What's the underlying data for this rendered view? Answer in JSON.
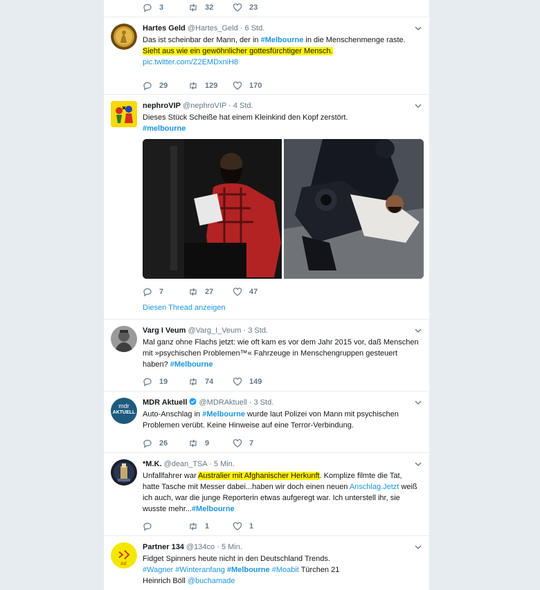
{
  "top_actions": {
    "replies": "3",
    "retweets": "32",
    "likes": "23"
  },
  "tweets": [
    {
      "name": "Hartes Geld",
      "handle": "@Hartes_Geld",
      "sep": "·",
      "time": "6 Std.",
      "text_pre": "Das ist scheinbar der Mann, der in ",
      "tag1": "#Melbourne",
      "text_post": " in die Menschenmenge raste.",
      "highlight": "Sieht aus wie ein gewöhnlicher gottesfürchtiger Mensch.",
      "link": "pic.twitter.com/Z2EMDxniH8",
      "replies": "29",
      "retweets": "129",
      "likes": "170"
    },
    {
      "name": "nephroVIP",
      "handle": "@nephroVIP",
      "sep": "·",
      "time": "4 Std.",
      "text": "Dieses Stück Scheiße hat einem Kleinkind den Kopf zerstört.",
      "tag1": "#melbourne",
      "replies": "7",
      "retweets": "27",
      "likes": "47",
      "thread": "Diesen Thread anzeigen"
    },
    {
      "name": "Varg I Veum",
      "handle": "@Varg_I_Veum",
      "sep": "·",
      "time": "3 Std.",
      "line1": "Mal ganz ohne Flachs jetzt: wie oft kam es vor dem Jahr 2015 vor, daß Menschen",
      "line2": "mit »psychischen Problemen™« Fahrzeuge in Menschengruppen gesteuert",
      "line3_pre": "haben? ",
      "tag1": "#Melbourne",
      "replies": "19",
      "retweets": "74",
      "likes": "149"
    },
    {
      "name": "MDR Aktuell",
      "handle": "@MDRAktuell",
      "sep": "·",
      "time": "3 Std.",
      "text_pre": "Auto-Anschlag in ",
      "tag1": "#Melbourne",
      "text_post": " wurde laut Polizei von Mann mit psychischen",
      "line2": "Problemen verübt. Keine Hinweise auf eine Terror-Verbindung.",
      "avatar_text": "mdr",
      "avatar_text2": "AKTUELL",
      "replies": "26",
      "retweets": "9",
      "likes": "7"
    },
    {
      "name": "*M.K.",
      "handle": "@dean_TSA",
      "sep": "·",
      "time": "5 Min.",
      "l1_pre": "Unfallfahrer war ",
      "l1_hl": "Australier mit Afghanischer Herkunft",
      "l1_post": ". Komplize filmte die Tat,",
      "l2_pre": "hatte Tasche mit Messer dabei...haben wir doch einen neuen ",
      "l2_link": "Anschlag.Jetzt",
      "l2_post": " weiß",
      "l3": "ich auch, war die junge Reporterin etwas aufgeregt war. Ich unterstell ihr, sie",
      "l4_pre": "wusste mehr...",
      "tag1": "#Melbourne",
      "replies": "",
      "retweets": "1",
      "likes": "1"
    },
    {
      "name": "Partner 134",
      "handle": "@134co",
      "sep": "·",
      "time": "5 Min.",
      "line1": "Fidget Spinners heute nicht in den Deutschland Trends.",
      "tags": [
        "#Wagner",
        "#Winteranfang",
        "#Melbourne",
        "#Moabit"
      ],
      "tags_post": " Türchen 21",
      "line3_pre": "Heinrich Böll ",
      "mention": "@buchamade"
    }
  ]
}
